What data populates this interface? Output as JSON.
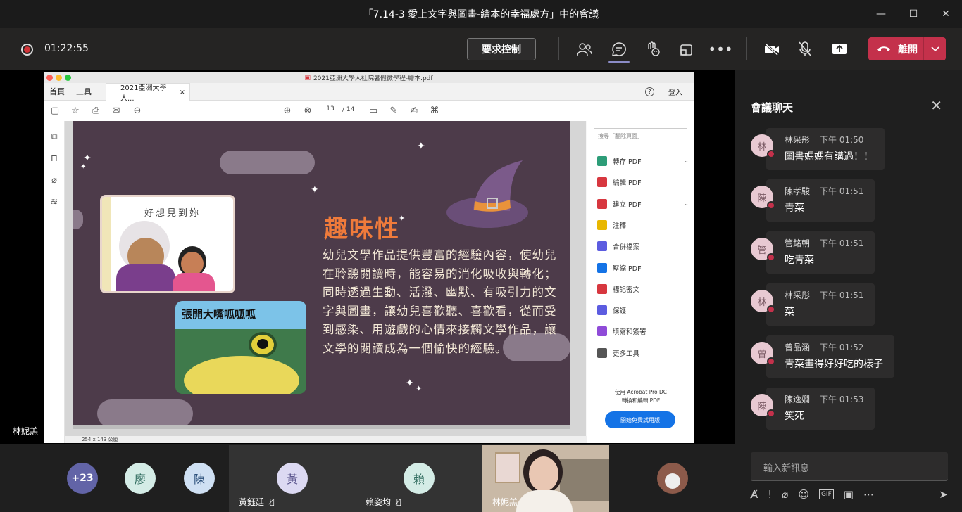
{
  "window": {
    "title": "「7.14-3 愛上文字與圖畫-繪本的幸福處方」中的會議"
  },
  "toolbar": {
    "timer": "01:22:55",
    "request_control": "要求控制",
    "leave_label": "離開"
  },
  "pdf": {
    "title": "2021亞洲大學人社院暑假微學程-繪本.pdf",
    "nav_home": "首頁",
    "nav_tools": "工具",
    "tab_label": "2021亞洲大學人...",
    "signin": "登入",
    "page_current": "13",
    "page_total": "/ 14",
    "dimensions": "254 x 143 公厘",
    "search_placeholder": "搜尋「翻除頁面」",
    "tools": [
      {
        "label": "轉存 PDF",
        "color": "#2d9d78",
        "chev": "⌄"
      },
      {
        "label": "編輯 PDF",
        "color": "#d7373f",
        "chev": ""
      },
      {
        "label": "建立 PDF",
        "color": "#d7373f",
        "chev": "⌄"
      },
      {
        "label": "注釋",
        "color": "#e8b700",
        "chev": ""
      },
      {
        "label": "合併檔案",
        "color": "#5c5ce0",
        "chev": ""
      },
      {
        "label": "壓縮 PDF",
        "color": "#1473e6",
        "chev": ""
      },
      {
        "label": "標記密文",
        "color": "#d7373f",
        "chev": ""
      },
      {
        "label": "保護",
        "color": "#5c5ce0",
        "chev": ""
      },
      {
        "label": "填寫和簽署",
        "color": "#8f4bd8",
        "chev": ""
      },
      {
        "label": "更多工具",
        "color": "#555555",
        "chev": ""
      }
    ],
    "promo_line1": "使用 Acrobat Pro DC",
    "promo_line2": "轉換和編輯 PDF",
    "promo_button": "開始免費試用版"
  },
  "slide": {
    "heading": "趣味性",
    "body": "幼兒文學作品提供豐富的經驗內容，使幼兒在聆聽閱讀時，能容易的消化吸收與轉化；同時透過生動、活潑、幽默、有吸引力的文字與圖畫，讓幼兒喜歡聽、喜歡看，從而受到感染、用遊戲的心情來接觸文學作品，讓文學的閱讀成為一個愉快的經驗。",
    "book1_title": "好想見到妳",
    "book2_title": "張開大嘴呱呱呱"
  },
  "stage": {
    "speaker_name": "林妮羔"
  },
  "participants": {
    "more_count": "+23",
    "avatars": [
      {
        "initial": "廖",
        "bg": "#d4ece6",
        "fg": "#2f6b5e"
      },
      {
        "initial": "陳",
        "bg": "#cfe0f3",
        "fg": "#2b4f7a"
      }
    ],
    "tiles": [
      {
        "initial": "黃",
        "name": "黃鈺廷",
        "bg": "#dcd9f2",
        "fg": "#4b4580"
      },
      {
        "initial": "賴",
        "name": "賴姿均",
        "bg": "#d4ece6",
        "fg": "#2f6b5e"
      }
    ],
    "video_name": "林妮羔"
  },
  "chat": {
    "title": "會議聊天",
    "input_placeholder": "輸入新訊息",
    "messages": [
      {
        "initial": "林",
        "name": "林采彤",
        "time": "下午 01:50",
        "text": "圖書媽媽有講過！！"
      },
      {
        "initial": "陳",
        "name": "陳孝駿",
        "time": "下午 01:51",
        "text": "青菜"
      },
      {
        "initial": "管",
        "name": "管銘朝",
        "time": "下午 01:51",
        "text": "吃青菜"
      },
      {
        "initial": "林",
        "name": "林采彤",
        "time": "下午 01:51",
        "text": "菜"
      },
      {
        "initial": "曾",
        "name": "曾品涵",
        "time": "下午 01:52",
        "text": "青菜畫得好好吃的樣子"
      },
      {
        "initial": "陳",
        "name": "陳逸嫺",
        "time": "下午 01:53",
        "text": "笑死"
      }
    ]
  }
}
